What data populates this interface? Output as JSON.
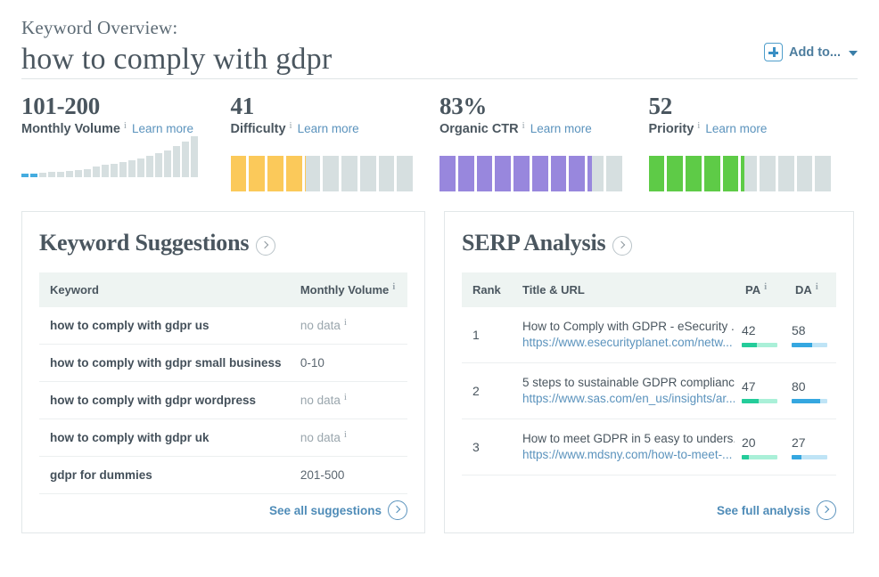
{
  "header": {
    "overview_label": "Keyword Overview:",
    "keyword": "how to comply with gdpr",
    "add_to_label": "Add to...",
    "plus_icon": "plus-icon",
    "caret_icon": "chevron-down-icon"
  },
  "metrics": [
    {
      "value": "101-200",
      "name": "Monthly Volume",
      "info": "i",
      "learn_more": "Learn more",
      "type": "histogram",
      "accent": "#45acdf",
      "track": "#d6dfe0",
      "bars": [
        3,
        3,
        5,
        6,
        6,
        7,
        8,
        9,
        11,
        13,
        14,
        16,
        18,
        20,
        23,
        26,
        29,
        33,
        38,
        44
      ],
      "highlighted": [
        0,
        1
      ]
    },
    {
      "value": "41",
      "name": "Difficulty",
      "info": "i",
      "learn_more": "Learn more",
      "type": "segments",
      "accent": "#fbc95a",
      "track": "#d6dfe0",
      "segments": 10,
      "percent": 41
    },
    {
      "value": "83%",
      "name": "Organic CTR",
      "info": "i",
      "learn_more": "Learn more",
      "type": "segments",
      "accent": "#9887dd",
      "track": "#d6dfe0",
      "segments": 10,
      "percent": 83
    },
    {
      "value": "52",
      "name": "Priority",
      "info": "i",
      "learn_more": "Learn more",
      "type": "segments",
      "accent": "#5ecb47",
      "track": "#d6dfe0",
      "segments": 10,
      "percent": 52
    }
  ],
  "keyword_suggestions": {
    "title": "Keyword Suggestions",
    "expand_icon": "circle-arrow-right-icon",
    "columns": [
      "Keyword",
      "Monthly Volume"
    ],
    "volume_header_info": "i",
    "rows": [
      {
        "keyword": "how to comply with gdpr us",
        "volume": "no data",
        "no_data": true,
        "info": "i"
      },
      {
        "keyword": "how to comply with gdpr small business",
        "volume": "0-10",
        "no_data": false,
        "info": ""
      },
      {
        "keyword": "how to comply with gdpr wordpress",
        "volume": "no data",
        "no_data": true,
        "info": "i"
      },
      {
        "keyword": "how to comply with gdpr uk",
        "volume": "no data",
        "no_data": true,
        "info": "i"
      },
      {
        "keyword": "gdpr for dummies",
        "volume": "201-500",
        "no_data": false,
        "info": ""
      }
    ],
    "footer_link": "See all suggestions",
    "footer_icon": "circle-arrow-right-icon"
  },
  "serp_analysis": {
    "title": "SERP Analysis",
    "expand_icon": "circle-arrow-right-icon",
    "columns": [
      "Rank",
      "Title & URL",
      "PA",
      "DA"
    ],
    "pa_info": "i",
    "da_info": "i",
    "rows": [
      {
        "rank": "1",
        "title": "How to Comply with GDPR - eSecurity ...",
        "url": "https://www.esecurityplanet.com/netw...",
        "pa": "42",
        "da": "58"
      },
      {
        "rank": "2",
        "title": "5 steps to sustainable GDPR complianc...",
        "url": "https://www.sas.com/en_us/insights/ar...",
        "pa": "47",
        "da": "80"
      },
      {
        "rank": "3",
        "title": "How to meet GDPR in 5 easy to unders...",
        "url": "https://www.mdsny.com/how-to-meet-...",
        "pa": "20",
        "da": "27"
      }
    ],
    "footer_link": "See full analysis",
    "footer_icon": "circle-arrow-right-icon"
  }
}
